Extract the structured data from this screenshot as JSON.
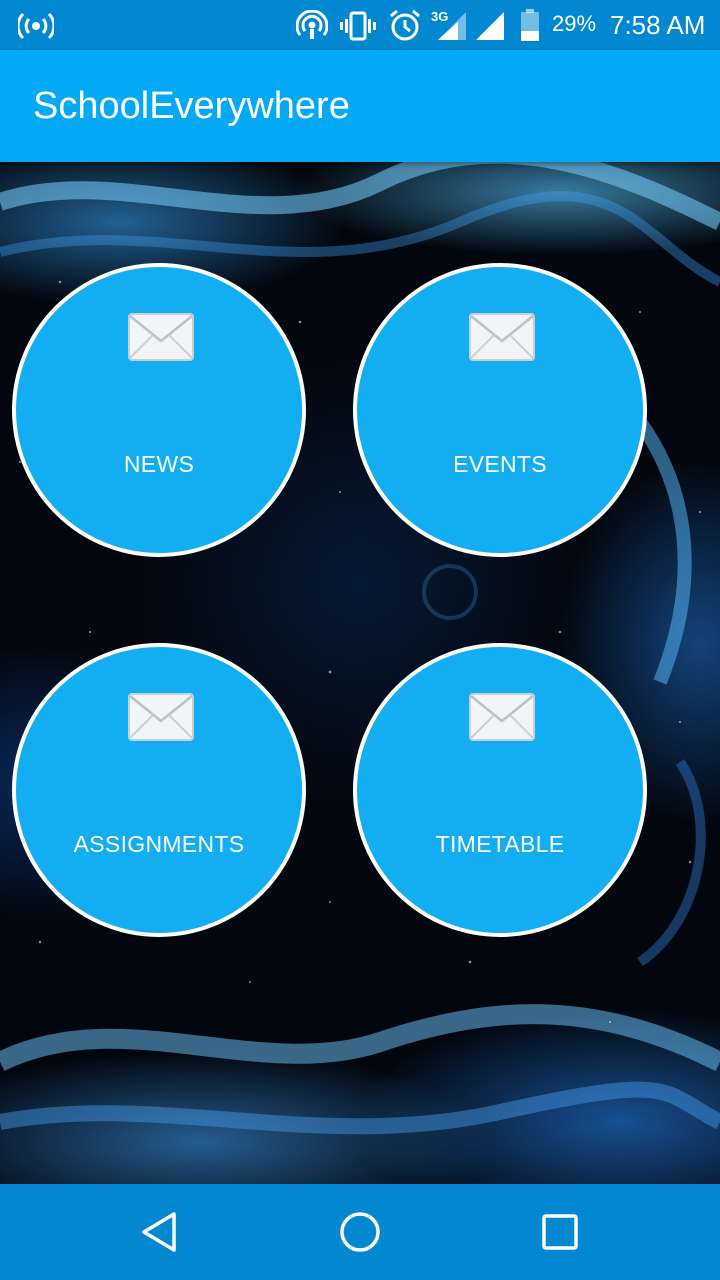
{
  "status_bar": {
    "battery_percent": "29%",
    "time": "7:58 AM",
    "network_type": "3G",
    "icons": [
      "hotspot-icon",
      "cast-icon",
      "vibrate-icon",
      "alarm-icon",
      "signal-3g-icon",
      "signal-icon",
      "battery-icon"
    ]
  },
  "app_bar": {
    "title": "SchoolEverywhere"
  },
  "tiles": [
    {
      "label": "NEWS",
      "icon": "mail-icon"
    },
    {
      "label": "EVENTS",
      "icon": "mail-icon"
    },
    {
      "label": "ASSIGNMENTS",
      "icon": "mail-icon"
    },
    {
      "label": "TIMETABLE",
      "icon": "mail-icon"
    }
  ],
  "nav_bar": {
    "icons": [
      "back-icon",
      "home-icon",
      "recents-icon"
    ]
  },
  "colors": {
    "status_bar": "#0288d1",
    "app_bar": "#03a9f4",
    "tile": "#13aef2",
    "nav_bar": "#0288d1"
  }
}
